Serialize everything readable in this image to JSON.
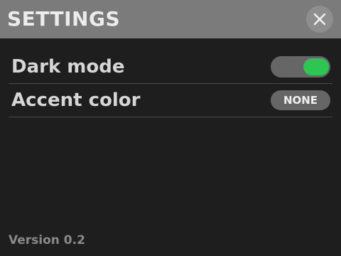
{
  "header": {
    "title": "SETTINGS",
    "close_icon": "close-icon"
  },
  "settings": {
    "dark_mode": {
      "label": "Dark mode",
      "enabled": true,
      "toggle_on_color": "#2ec552"
    },
    "accent_color": {
      "label": "Accent color",
      "value": "NONE"
    }
  },
  "footer": {
    "version": "Version 0.2"
  },
  "colors": {
    "background": "#1e1e1e",
    "header": "#7b7b7b",
    "control": "#666666"
  }
}
